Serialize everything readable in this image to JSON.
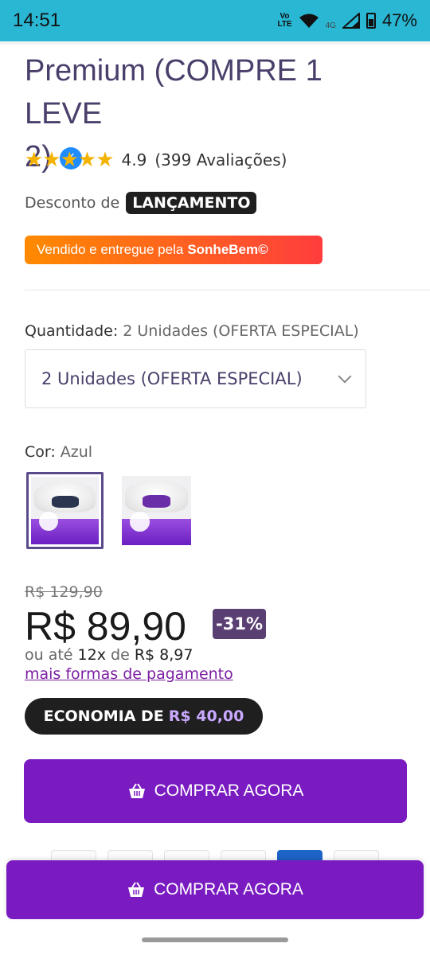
{
  "status": {
    "time": "14:51",
    "volte": "Vo LTE",
    "network": "4G",
    "battery": "47%"
  },
  "product": {
    "title_line1": "Premium (COMPRE 1 LEVE",
    "title_line2": "2)",
    "rating": "4.9",
    "reviews": "(399 Avaliações)",
    "stars": 5
  },
  "discount": {
    "label": "Desconto de",
    "badge": "LANÇAMENTO"
  },
  "seller": {
    "prefix": "Vendido e entregue pela",
    "name": "SonheBem©"
  },
  "quantity": {
    "label": "Quantidade:",
    "value": "2 Unidades (OFERTA ESPECIAL)",
    "selected": "2 Unidades (OFERTA ESPECIAL)"
  },
  "color": {
    "label": "Cor:",
    "value": "Azul",
    "swatches": [
      "Azul",
      "Roxo"
    ]
  },
  "price": {
    "old": "R$ 129,90",
    "current": "R$ 89,90",
    "discount_pct": "-31%",
    "installment_prefix": "ou até",
    "installment_count": "12x",
    "installment_mid": "de",
    "installment_value": "R$ 8,97",
    "more_payment": "mais formas de pagamento"
  },
  "economy": {
    "label": "ECONOMIA DE",
    "amount": "R$ 40,00"
  },
  "buttons": {
    "buy": "COMPRAR AGORA",
    "sticky_buy": "COMPRAR AGORA"
  },
  "colors": {
    "accent": "#7a1bc2",
    "status_bar": "#29b7d4",
    "price_badge": "#5a3f73"
  }
}
